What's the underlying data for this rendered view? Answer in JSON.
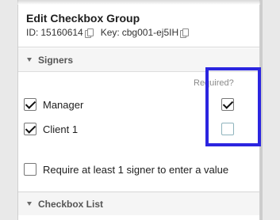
{
  "panel": {
    "title": "Edit Checkbox Group",
    "id_label": "ID:",
    "id_value": "15160614",
    "key_label": "Key:",
    "key_value": "cbg001-ej5IH"
  },
  "sections": {
    "signers": {
      "label": "Signers"
    },
    "checkbox_list": {
      "label": "Checkbox List"
    }
  },
  "required_label": "Required?",
  "signers": [
    {
      "label": "Manager",
      "checked": true,
      "required": true
    },
    {
      "label": "Client 1",
      "checked": true,
      "required": false
    }
  ],
  "require_one": {
    "label": "Require at least 1 signer to enter a value",
    "checked": false
  },
  "colors": {
    "highlight": "#2b25e0",
    "required_unchecked_border": "#8fb4bd"
  }
}
